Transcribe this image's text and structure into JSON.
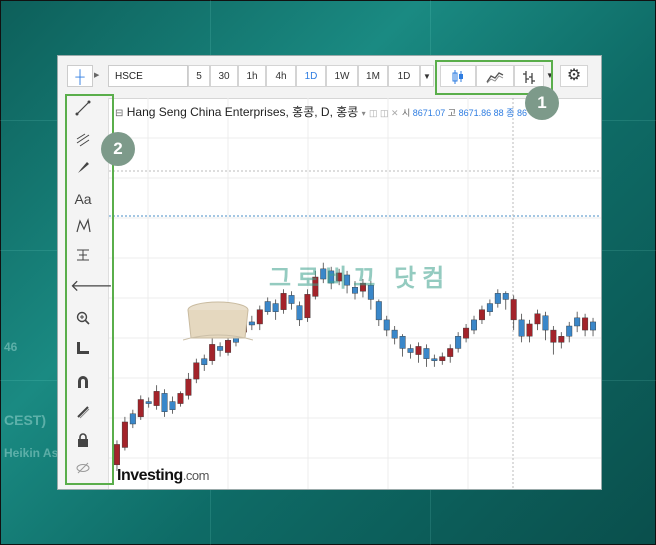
{
  "toolbar": {
    "symbol": "HSCE",
    "intervals": [
      "5",
      "30",
      "1h",
      "4h",
      "1D",
      "1W",
      "1M",
      "1D"
    ],
    "active_interval": "1D",
    "chart_style_icons": [
      "candlestick-icon",
      "area-icon",
      "bar-icon"
    ],
    "settings_icon": "gear-icon"
  },
  "legend": {
    "title": "Hang Seng China Enterprises, 홍콩, D, 홍콩",
    "open_label": "시",
    "open_value": "8671.07",
    "high_label": "고",
    "high_value": "8671.86",
    "tail": "88 종 86"
  },
  "annotations": {
    "badge_1": "1",
    "badge_2": "2",
    "accent_color": "#5aae4b"
  },
  "tools": [
    "trend-line-icon",
    "fib-icon",
    "brush-icon",
    "Aa",
    "pattern-icon",
    "measure-icon",
    "arrow-left-icon",
    "zoom-icon",
    "ruler-icon",
    "magnet-icon",
    "pencil-lock-icon",
    "lock-icon",
    "eye-hidden-icon"
  ],
  "logo": {
    "name": "Investing",
    "suffix": ".com"
  },
  "watermark": "그로비끄 닷컴",
  "background_texts": [
    "CEST)",
    "Heikin As",
    "46"
  ],
  "chart_data": {
    "type": "candlestick",
    "candles": [
      {
        "o": 8,
        "c": 28,
        "l": 2,
        "h": 32,
        "up": false
      },
      {
        "o": 25,
        "c": 50,
        "l": 22,
        "h": 55,
        "up": false
      },
      {
        "o": 48,
        "c": 58,
        "l": 44,
        "h": 62,
        "up": true
      },
      {
        "o": 55,
        "c": 72,
        "l": 52,
        "h": 76,
        "up": false
      },
      {
        "o": 70,
        "c": 68,
        "l": 64,
        "h": 74,
        "up": true
      },
      {
        "o": 66,
        "c": 80,
        "l": 62,
        "h": 86,
        "up": false
      },
      {
        "o": 78,
        "c": 60,
        "l": 55,
        "h": 82,
        "up": true
      },
      {
        "o": 62,
        "c": 70,
        "l": 58,
        "h": 75,
        "up": true
      },
      {
        "o": 68,
        "c": 78,
        "l": 65,
        "h": 80,
        "up": false
      },
      {
        "o": 76,
        "c": 92,
        "l": 72,
        "h": 98,
        "up": false
      },
      {
        "o": 92,
        "c": 108,
        "l": 88,
        "h": 112,
        "up": false
      },
      {
        "o": 106,
        "c": 112,
        "l": 100,
        "h": 116,
        "up": true
      },
      {
        "o": 110,
        "c": 126,
        "l": 106,
        "h": 132,
        "up": false
      },
      {
        "o": 124,
        "c": 120,
        "l": 114,
        "h": 128,
        "up": true
      },
      {
        "o": 118,
        "c": 130,
        "l": 115,
        "h": 136,
        "up": false
      },
      {
        "o": 128,
        "c": 140,
        "l": 124,
        "h": 144,
        "up": true
      },
      {
        "o": 138,
        "c": 150,
        "l": 134,
        "h": 154,
        "up": false
      },
      {
        "o": 148,
        "c": 145,
        "l": 140,
        "h": 154,
        "up": true
      },
      {
        "o": 146,
        "c": 160,
        "l": 140,
        "h": 164,
        "up": false
      },
      {
        "o": 158,
        "c": 168,
        "l": 155,
        "h": 172,
        "up": true
      },
      {
        "o": 166,
        "c": 158,
        "l": 150,
        "h": 170,
        "up": true
      },
      {
        "o": 160,
        "c": 176,
        "l": 156,
        "h": 180,
        "up": false
      },
      {
        "o": 174,
        "c": 166,
        "l": 160,
        "h": 178,
        "up": true
      },
      {
        "o": 164,
        "c": 150,
        "l": 144,
        "h": 168,
        "up": true
      },
      {
        "o": 152,
        "c": 175,
        "l": 148,
        "h": 180,
        "up": false
      },
      {
        "o": 173,
        "c": 192,
        "l": 170,
        "h": 198,
        "up": false
      },
      {
        "o": 190,
        "c": 200,
        "l": 186,
        "h": 206,
        "up": true
      },
      {
        "o": 198,
        "c": 186,
        "l": 180,
        "h": 202,
        "up": true
      },
      {
        "o": 188,
        "c": 196,
        "l": 184,
        "h": 200,
        "up": false
      },
      {
        "o": 194,
        "c": 184,
        "l": 176,
        "h": 198,
        "up": true
      },
      {
        "o": 182,
        "c": 176,
        "l": 170,
        "h": 188,
        "up": true
      },
      {
        "o": 178,
        "c": 186,
        "l": 172,
        "h": 190,
        "up": false
      },
      {
        "o": 184,
        "c": 170,
        "l": 160,
        "h": 188,
        "up": true
      },
      {
        "o": 168,
        "c": 150,
        "l": 144,
        "h": 170,
        "up": true
      },
      {
        "o": 150,
        "c": 140,
        "l": 134,
        "h": 154,
        "up": true
      },
      {
        "o": 140,
        "c": 132,
        "l": 126,
        "h": 144,
        "up": true
      },
      {
        "o": 134,
        "c": 122,
        "l": 114,
        "h": 136,
        "up": true
      },
      {
        "o": 122,
        "c": 118,
        "l": 112,
        "h": 126,
        "up": true
      },
      {
        "o": 116,
        "c": 124,
        "l": 108,
        "h": 128,
        "up": false
      },
      {
        "o": 122,
        "c": 112,
        "l": 104,
        "h": 126,
        "up": true
      },
      {
        "o": 112,
        "c": 110,
        "l": 104,
        "h": 116,
        "up": true
      },
      {
        "o": 110,
        "c": 114,
        "l": 106,
        "h": 118,
        "up": false
      },
      {
        "o": 114,
        "c": 122,
        "l": 108,
        "h": 126,
        "up": false
      },
      {
        "o": 122,
        "c": 134,
        "l": 118,
        "h": 138,
        "up": true
      },
      {
        "o": 132,
        "c": 142,
        "l": 128,
        "h": 146,
        "up": false
      },
      {
        "o": 140,
        "c": 150,
        "l": 136,
        "h": 154,
        "up": true
      },
      {
        "o": 150,
        "c": 160,
        "l": 146,
        "h": 164,
        "up": false
      },
      {
        "o": 158,
        "c": 166,
        "l": 154,
        "h": 170,
        "up": true
      },
      {
        "o": 166,
        "c": 176,
        "l": 162,
        "h": 180,
        "up": true
      },
      {
        "o": 176,
        "c": 170,
        "l": 160,
        "h": 178,
        "up": true
      },
      {
        "o": 170,
        "c": 150,
        "l": 140,
        "h": 174,
        "up": false
      },
      {
        "o": 150,
        "c": 134,
        "l": 128,
        "h": 156,
        "up": true
      },
      {
        "o": 134,
        "c": 146,
        "l": 128,
        "h": 150,
        "up": false
      },
      {
        "o": 146,
        "c": 156,
        "l": 140,
        "h": 160,
        "up": false
      },
      {
        "o": 154,
        "c": 140,
        "l": 130,
        "h": 158,
        "up": true
      },
      {
        "o": 140,
        "c": 128,
        "l": 116,
        "h": 144,
        "up": false
      },
      {
        "o": 128,
        "c": 134,
        "l": 122,
        "h": 138,
        "up": false
      },
      {
        "o": 134,
        "c": 144,
        "l": 128,
        "h": 148,
        "up": true
      },
      {
        "o": 144,
        "c": 152,
        "l": 138,
        "h": 158,
        "up": true
      },
      {
        "o": 152,
        "c": 140,
        "l": 134,
        "h": 156,
        "up": false
      },
      {
        "o": 140,
        "c": 148,
        "l": 134,
        "h": 152,
        "up": true
      }
    ],
    "up_color": "#3a87c9",
    "down_color": "#a3232a",
    "ylim": [
      0,
      240
    ]
  }
}
